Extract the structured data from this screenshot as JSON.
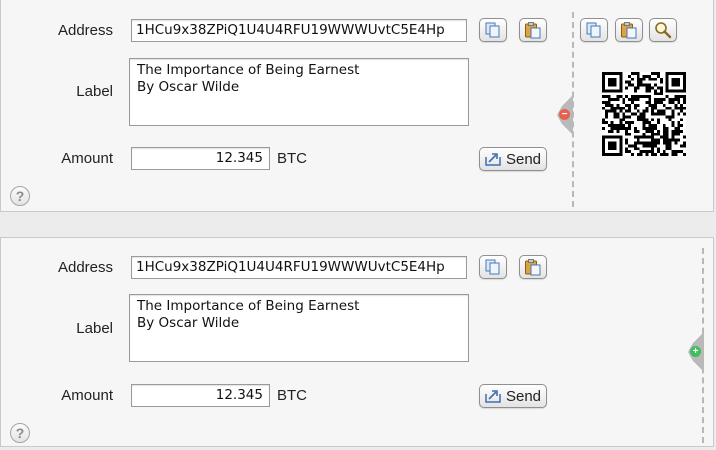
{
  "top_panel": {
    "address_label": "Address",
    "address_value": "1HCu9x38ZPiQ1U4U4RFU19WWWUvtC5E4Hp",
    "label_label": "Label",
    "label_value": "The Importance of Being Earnest\nBy Oscar Wilde",
    "amount_label": "Amount",
    "amount_value": "12.345",
    "currency": "BTC",
    "send_label": "Send",
    "help_glyph": "?",
    "collapse_glyph": "−",
    "collapse_color": "#e8604f",
    "sidebar_icons": [
      "copy-icon",
      "paste-icon",
      "zoom-icon"
    ]
  },
  "bottom_panel": {
    "address_label": "Address",
    "address_value": "1HCu9x38ZPiQ1U4U4RFU19WWWUvtC5E4Hp",
    "label_label": "Label",
    "label_value": "The Importance of Being Earnest\nBy Oscar Wilde",
    "amount_label": "Amount",
    "amount_value": "12.345",
    "currency": "BTC",
    "send_label": "Send",
    "help_glyph": "?",
    "expand_glyph": "+",
    "expand_color": "#3fbf5a"
  }
}
